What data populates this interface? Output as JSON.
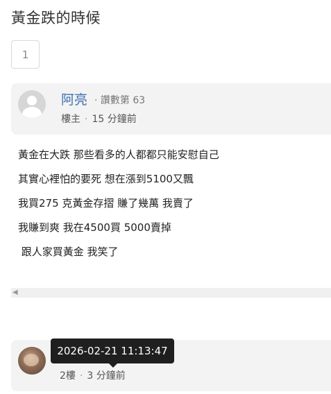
{
  "thread": {
    "title": "黃金跌的時候"
  },
  "pagination": {
    "current_page": "1"
  },
  "op": {
    "author": "阿亮",
    "reads": "· 讚數第 63",
    "role": "樓主",
    "time": "15 分鐘前",
    "content": [
      "黃金在大跌 那些看多的人都都只能安慰自己",
      "其實心裡怕的要死 想在漲到5100又飄",
      "我買275 克黃金存摺 賺了幾萬 我賣了",
      "我賺到爽 我在4500買 5000賣掉",
      " 跟人家買黃金 我笑了"
    ]
  },
  "reply": {
    "floor": "2樓",
    "time": "3 分鐘前",
    "tooltip": "2026-02-21 11:13:47"
  }
}
